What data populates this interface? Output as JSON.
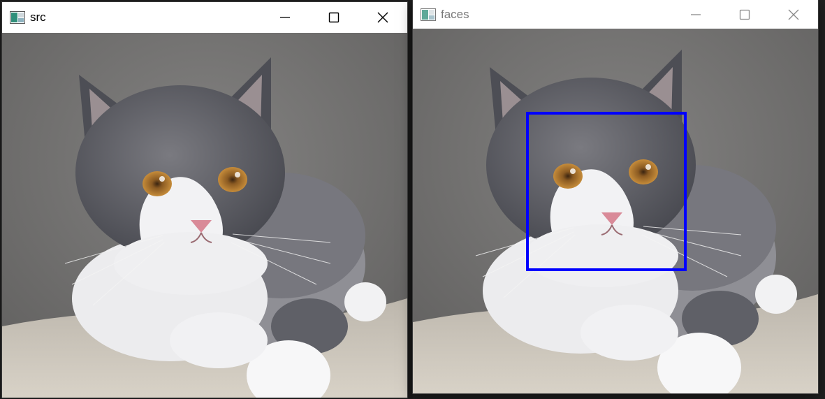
{
  "windows": {
    "src": {
      "title": "src",
      "icon": "opencv-window-icon",
      "controls": [
        "minimize-icon",
        "maximize-icon",
        "close-icon"
      ]
    },
    "faces": {
      "title": "faces",
      "icon": "opencv-window-icon",
      "controls": [
        "minimize-icon",
        "maximize-icon",
        "close-icon"
      ],
      "detection_box_color": "#0000ff"
    }
  },
  "colors": {
    "titlebar_bg": "#ffffff",
    "inactive_title": "#7a7a7a",
    "detection_box": "#0000ff"
  }
}
